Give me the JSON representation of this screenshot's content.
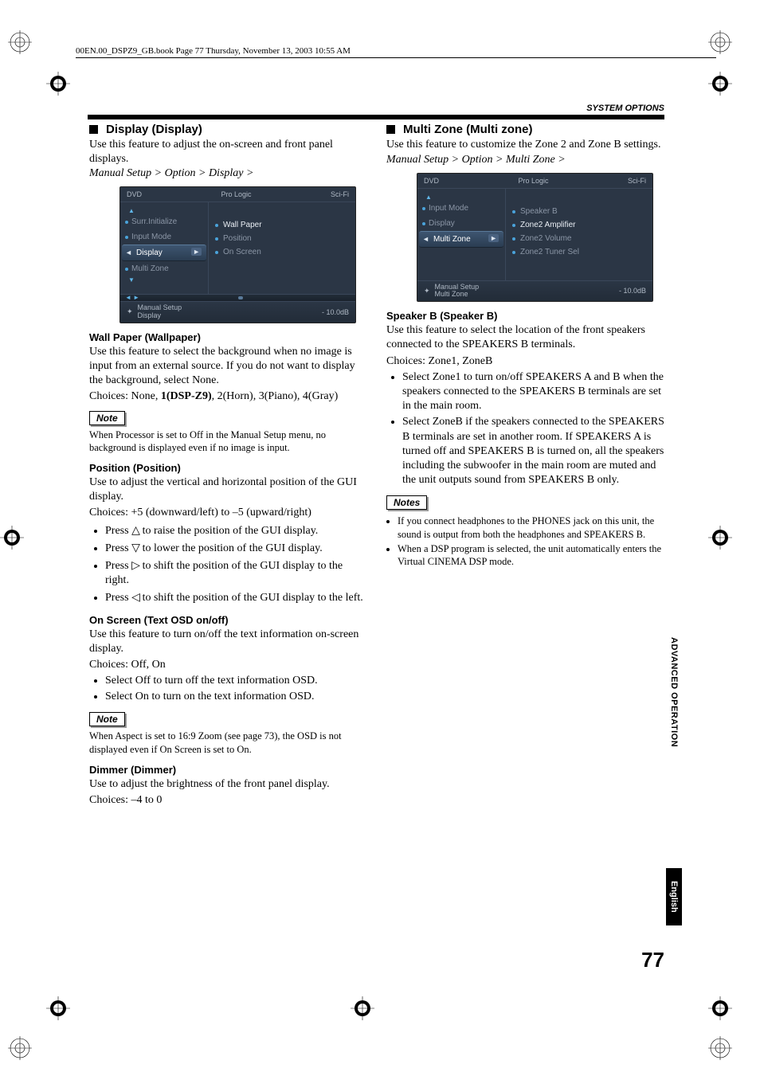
{
  "header": "00EN.00_DSPZ9_GB.book  Page 77  Thursday, November 13, 2003  10:55 AM",
  "section_label": "SYSTEM OPTIONS",
  "page_num": "77",
  "side": {
    "advanced": "ADVANCED OPERATION",
    "english": "English"
  },
  "left": {
    "h": "Display (Display)",
    "intro": "Use this feature to adjust the on-screen and front panel displays.",
    "bc": "Manual Setup > Option > Display >",
    "gui": {
      "top1": "DVD",
      "top2": "Pro Logic",
      "top3": "Sci-Fi",
      "menu": [
        "Surr.Initialize",
        "Input Mode",
        "Display",
        "Multi Zone"
      ],
      "selected": "Display",
      "subs": [
        "Wall Paper",
        "Position",
        "On Screen"
      ],
      "footer1": "Manual Setup",
      "footer2": "Display",
      "vol": "- 10.0dB"
    },
    "wallpaper": {
      "h": "Wall Paper (Wallpaper)",
      "p": "Use this feature to select the background when no image is input from an external source. If you do not want to display the background, select None.",
      "choices_pre": "Choices: None, ",
      "choices_bold": "1(DSP-Z9)",
      "choices_post": ", 2(Horn), 3(Piano), 4(Gray)",
      "note_label": "Note",
      "note": "When Processor is set to Off in the Manual Setup menu, no background is displayed even if no image is input."
    },
    "position": {
      "h": "Position (Position)",
      "p": "Use to adjust the vertical and horizontal position of the GUI display.",
      "choices": "Choices: +5 (downward/left) to –5 (upward/right)",
      "b1a": "Press ",
      "b1b": " to raise the position of the GUI display.",
      "b2a": "Press ",
      "b2b": " to lower the position of the GUI display.",
      "b3a": "Press ",
      "b3b": " to shift the position of the GUI display to the right.",
      "b4a": "Press ",
      "b4b": " to shift the position of the GUI display to the left."
    },
    "onscreen": {
      "h": "On Screen (Text OSD on/off)",
      "p": "Use this feature to turn on/off the text information on-screen display.",
      "choices": "Choices: Off, On",
      "b1": "Select Off to turn off the text information OSD.",
      "b2": "Select On to turn on the text information OSD.",
      "note_label": "Note",
      "note": "When Aspect is set to 16:9 Zoom (see page 73), the OSD is not displayed even if On Screen is set to On."
    },
    "dimmer": {
      "h": "Dimmer (Dimmer)",
      "p": "Use to adjust the brightness of the front panel display.",
      "choices": "Choices: –4 to 0"
    }
  },
  "right": {
    "h": "Multi Zone (Multi zone)",
    "intro": "Use this feature to customize the Zone 2 and Zone B settings.",
    "bc": "Manual Setup > Option > Multi Zone >",
    "gui": {
      "top1": "DVD",
      "top2": "Pro Logic",
      "top3": "Sci-Fi",
      "menu": [
        "Input Mode",
        "Display",
        "Multi Zone"
      ],
      "selected": "Multi Zone",
      "subs": [
        "Speaker B",
        "Zone2 Amplifier",
        "Zone2 Volume",
        "Zone2 Tuner Sel"
      ],
      "footer1": "Manual Setup",
      "footer2": "Multi Zone",
      "vol": "- 10.0dB"
    },
    "speakerb": {
      "h": "Speaker B (Speaker B)",
      "p": "Use this feature to select the location of the front speakers connected to the SPEAKERS B terminals.",
      "choices": "Choices: Zone1, ZoneB",
      "b1": "Select Zone1 to turn on/off SPEAKERS A and B when the speakers connected to the SPEAKERS B terminals are set in the main room.",
      "b2": "Select ZoneB if the speakers connected to the SPEAKERS B terminals are set in another room. If SPEAKERS A is turned off and SPEAKERS B is turned on, all the speakers including the subwoofer in the main room are muted and the unit outputs sound from SPEAKERS B only."
    },
    "notes_label": "Notes",
    "notes": [
      "If you connect headphones to the PHONES jack on this unit, the sound is output from both the headphones and SPEAKERS B.",
      "When a DSP program is selected, the unit automatically enters the Virtual CINEMA DSP mode."
    ]
  }
}
